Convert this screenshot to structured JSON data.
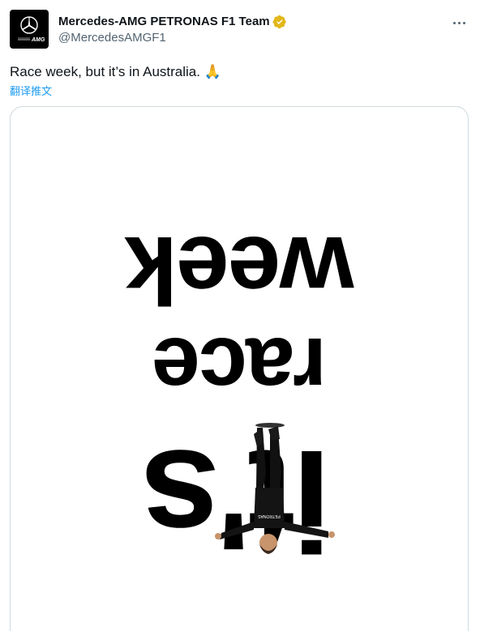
{
  "account": {
    "display_name": "Mercedes-AMG PETRONAS F1 Team",
    "handle": "@MercedesAMGF1",
    "avatar_icon": "mercedes-star-amg-logo",
    "avatar_logo_text": "AMG",
    "verified_icon": "gold-verified-badge"
  },
  "tweet": {
    "text": "Race week, but it’s in Australia. 🙏",
    "translate_label": "翻译推文"
  },
  "media": {
    "words": [
      "week",
      "race",
      "it's"
    ],
    "shirt_text": "PETRONAS"
  },
  "colors": {
    "verified_gold": "#e2b719",
    "link_blue": "#1d9bf0",
    "text_primary": "#0f1419",
    "text_secondary": "#536471",
    "border": "#cfd9de"
  }
}
